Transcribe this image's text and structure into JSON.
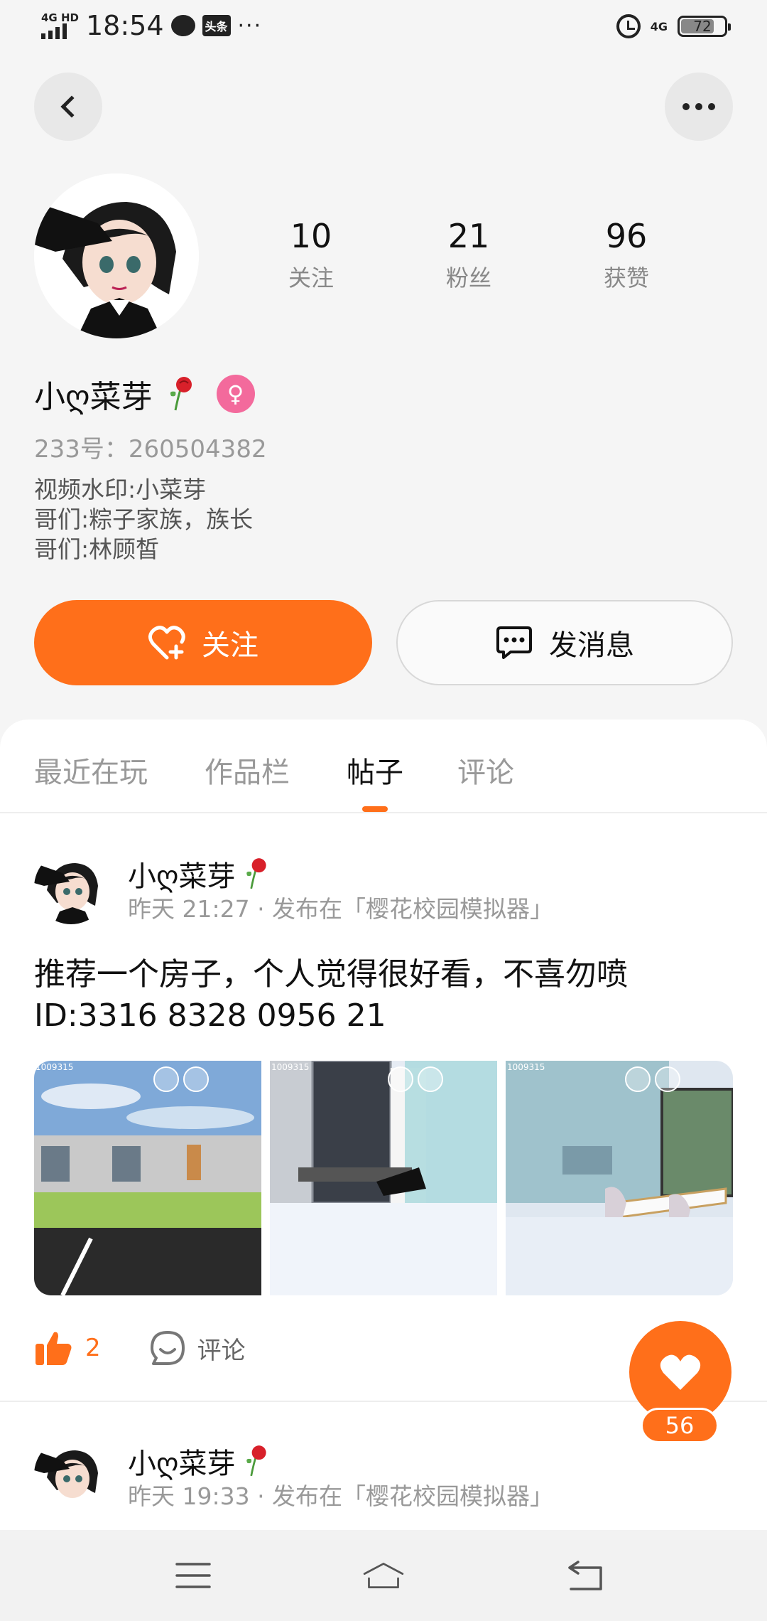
{
  "status_bar": {
    "network": "4G HD",
    "time": "18:54",
    "toutiao_label": "头条",
    "more": "···",
    "net_right": "4G",
    "battery": "72"
  },
  "profile": {
    "nickname": "小ღ菜芽",
    "uid": "233号：260504382",
    "bio": [
      "视频水印:小菜芽",
      "哥们:粽子家族，族长",
      "哥们:林顾皙"
    ],
    "stats": [
      {
        "num": "10",
        "label": "关注"
      },
      {
        "num": "21",
        "label": "粉丝"
      },
      {
        "num": "96",
        "label": "获赞"
      }
    ],
    "follow_label": "关注",
    "message_label": "发消息"
  },
  "tabs": [
    {
      "label": "最近在玩",
      "active": false
    },
    {
      "label": "作品栏",
      "active": false
    },
    {
      "label": "帖子",
      "active": true
    },
    {
      "label": "评论",
      "active": false
    }
  ],
  "posts": [
    {
      "author": "小ღ菜芽",
      "meta": "昨天 21:27 · 发布在「樱花校园模拟器」",
      "text_line1": "推荐一个房子，个人觉得很好看，不喜勿喷",
      "text_line2": "ID:3316 8328 0956 21",
      "image_watermark": "1009315",
      "likes": "2",
      "comment_label": "评论"
    },
    {
      "author": "小ღ菜芽",
      "meta": "昨天 19:33 · 发布在「樱花校园模拟器」"
    }
  ],
  "fab": {
    "count": "56"
  },
  "colors": {
    "accent": "#ff6f1a",
    "gender": "#f36a9c"
  }
}
